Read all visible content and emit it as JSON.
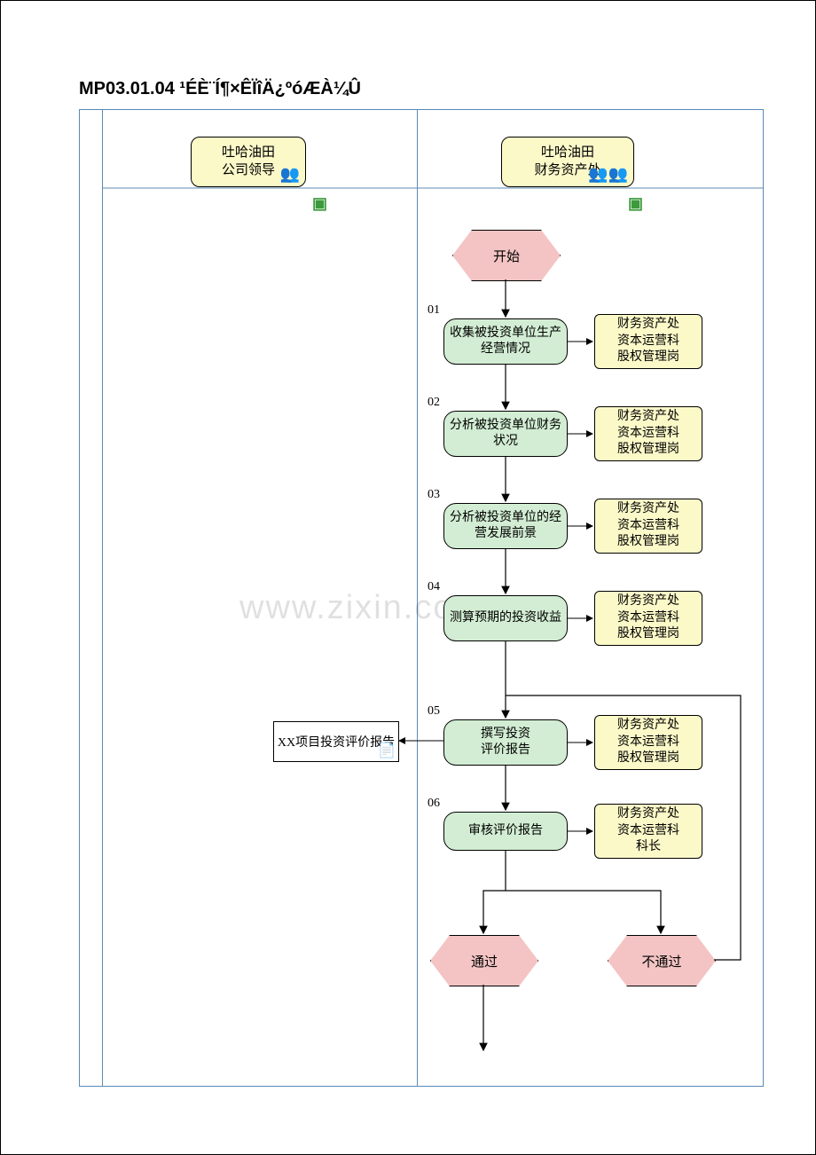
{
  "title": "MP03.01.04 ¹ÉÈ¨Í¶×ÊÏîÄ¿ºóÆÀ¼Û",
  "lanes": {
    "left": {
      "l1": "吐哈油田",
      "l2": "公司领导"
    },
    "right": {
      "l1": "吐哈油田",
      "l2": "财务资产处"
    }
  },
  "start": "开始",
  "steps": {
    "n01": "01",
    "n02": "02",
    "n03": "03",
    "n04": "04",
    "n05": "05",
    "n06": "06"
  },
  "proc": {
    "p1": "收集被投资单位生产经营情况",
    "p2": "分析被投资单位财务状况",
    "p3": "分析被投资单位的经营发展前景",
    "p4": "测算预期的投资收益",
    "p5": "撰写投资\n评价报告",
    "p6": "审核评价报告"
  },
  "roles": {
    "r1": "财务资产处\n资本运营科\n股权管理岗",
    "r6": "财务资产处\n资本运营科\n科长"
  },
  "doc": "XX项目投资评价报告",
  "dec": {
    "pass": "通过",
    "fail": "不通过"
  },
  "watermark": "www.zixin.com.cn"
}
